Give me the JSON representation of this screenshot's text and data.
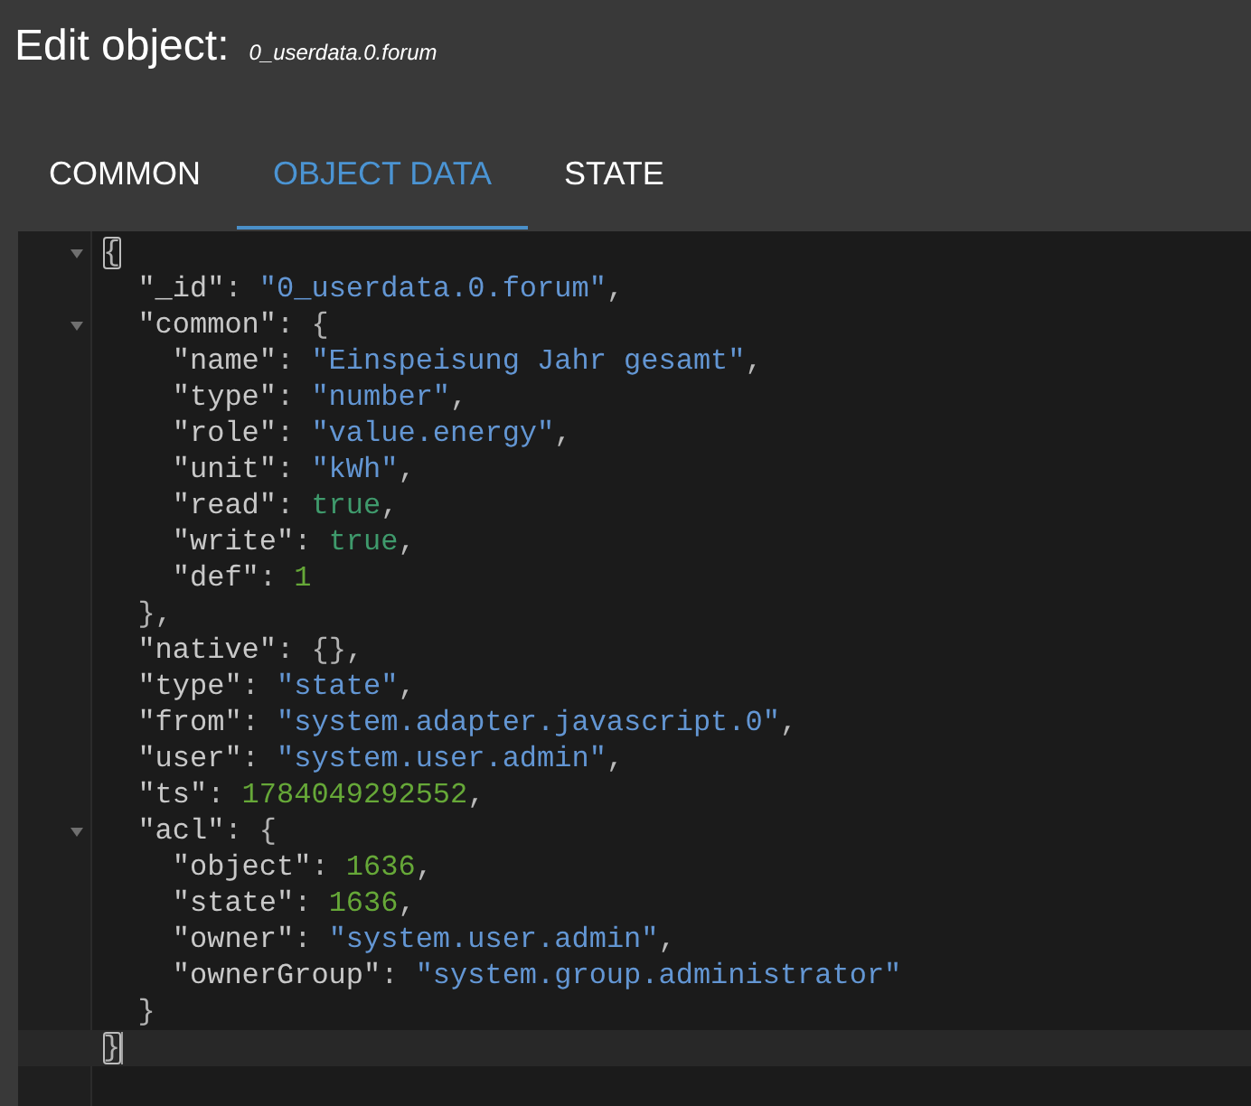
{
  "header": {
    "title": "Edit object:",
    "object_id": "0_userdata.0.forum"
  },
  "tabs": [
    {
      "label": "COMMON",
      "selected": false
    },
    {
      "label": "OBJECT DATA",
      "selected": true
    },
    {
      "label": "STATE",
      "selected": false
    }
  ],
  "editor": {
    "lines": [
      {
        "tokens": [
          {
            "kind": "bracket",
            "text": "{",
            "matched": true
          }
        ],
        "expanded": true,
        "active": false,
        "children": [
          {
            "tokens": [
              {
                "kind": "key",
                "text": "\"_id\""
              },
              {
                "kind": "punct",
                "text": ": "
              },
              {
                "kind": "string",
                "text": "\"0_userdata.0.forum\""
              },
              {
                "kind": "punct",
                "text": ","
              }
            ],
            "active": false
          },
          {
            "tokens": [
              {
                "kind": "key",
                "text": "\"common\""
              },
              {
                "kind": "punct",
                "text": ": "
              },
              {
                "kind": "bracket",
                "text": "{",
                "matched": false
              }
            ],
            "expanded": true,
            "active": false,
            "children": [
              {
                "tokens": [
                  {
                    "kind": "key",
                    "text": "\"name\""
                  },
                  {
                    "kind": "punct",
                    "text": ": "
                  },
                  {
                    "kind": "string",
                    "text": "\"Einspeisung Jahr gesamt\""
                  },
                  {
                    "kind": "punct",
                    "text": ","
                  }
                ],
                "active": false
              },
              {
                "tokens": [
                  {
                    "kind": "key",
                    "text": "\"type\""
                  },
                  {
                    "kind": "punct",
                    "text": ": "
                  },
                  {
                    "kind": "string",
                    "text": "\"number\""
                  },
                  {
                    "kind": "punct",
                    "text": ","
                  }
                ],
                "active": false
              },
              {
                "tokens": [
                  {
                    "kind": "key",
                    "text": "\"role\""
                  },
                  {
                    "kind": "punct",
                    "text": ": "
                  },
                  {
                    "kind": "string",
                    "text": "\"value.energy\""
                  },
                  {
                    "kind": "punct",
                    "text": ","
                  }
                ],
                "active": false
              },
              {
                "tokens": [
                  {
                    "kind": "key",
                    "text": "\"unit\""
                  },
                  {
                    "kind": "punct",
                    "text": ": "
                  },
                  {
                    "kind": "string",
                    "text": "\"kWh\""
                  },
                  {
                    "kind": "punct",
                    "text": ","
                  }
                ],
                "active": false
              },
              {
                "tokens": [
                  {
                    "kind": "key",
                    "text": "\"read\""
                  },
                  {
                    "kind": "punct",
                    "text": ": "
                  },
                  {
                    "kind": "boolean",
                    "text": "true"
                  },
                  {
                    "kind": "punct",
                    "text": ","
                  }
                ],
                "active": false
              },
              {
                "tokens": [
                  {
                    "kind": "key",
                    "text": "\"write\""
                  },
                  {
                    "kind": "punct",
                    "text": ": "
                  },
                  {
                    "kind": "boolean",
                    "text": "true"
                  },
                  {
                    "kind": "punct",
                    "text": ","
                  }
                ],
                "active": false
              },
              {
                "tokens": [
                  {
                    "kind": "key",
                    "text": "\"def\""
                  },
                  {
                    "kind": "punct",
                    "text": ": "
                  },
                  {
                    "kind": "number",
                    "text": "1"
                  }
                ],
                "active": false
              }
            ]
          },
          {
            "tokens": [
              {
                "kind": "bracket",
                "text": "}",
                "matched": false
              },
              {
                "kind": "punct",
                "text": ","
              }
            ],
            "active": false
          },
          {
            "tokens": [
              {
                "kind": "key",
                "text": "\"native\""
              },
              {
                "kind": "punct",
                "text": ": "
              },
              {
                "kind": "bracket",
                "text": "{",
                "matched": false
              },
              {
                "kind": "bracket",
                "text": "}",
                "matched": false
              },
              {
                "kind": "punct",
                "text": ","
              }
            ],
            "active": false
          },
          {
            "tokens": [
              {
                "kind": "key",
                "text": "\"type\""
              },
              {
                "kind": "punct",
                "text": ": "
              },
              {
                "kind": "string",
                "text": "\"state\""
              },
              {
                "kind": "punct",
                "text": ","
              }
            ],
            "active": false
          },
          {
            "tokens": [
              {
                "kind": "key",
                "text": "\"from\""
              },
              {
                "kind": "punct",
                "text": ": "
              },
              {
                "kind": "string",
                "text": "\"system.adapter.javascript.0\""
              },
              {
                "kind": "punct",
                "text": ","
              }
            ],
            "active": false
          },
          {
            "tokens": [
              {
                "kind": "key",
                "text": "\"user\""
              },
              {
                "kind": "punct",
                "text": ": "
              },
              {
                "kind": "string",
                "text": "\"system.user.admin\""
              },
              {
                "kind": "punct",
                "text": ","
              }
            ],
            "active": false
          },
          {
            "tokens": [
              {
                "kind": "key",
                "text": "\"ts\""
              },
              {
                "kind": "punct",
                "text": ": "
              },
              {
                "kind": "number",
                "text": "1784049292552"
              },
              {
                "kind": "punct",
                "text": ","
              }
            ],
            "active": false
          },
          {
            "tokens": [
              {
                "kind": "key",
                "text": "\"acl\""
              },
              {
                "kind": "punct",
                "text": ": "
              },
              {
                "kind": "bracket",
                "text": "{",
                "matched": false
              }
            ],
            "expanded": true,
            "active": false,
            "children": [
              {
                "tokens": [
                  {
                    "kind": "key",
                    "text": "\"object\""
                  },
                  {
                    "kind": "punct",
                    "text": ": "
                  },
                  {
                    "kind": "number",
                    "text": "1636"
                  },
                  {
                    "kind": "punct",
                    "text": ","
                  }
                ],
                "active": false
              },
              {
                "tokens": [
                  {
                    "kind": "key",
                    "text": "\"state\""
                  },
                  {
                    "kind": "punct",
                    "text": ": "
                  },
                  {
                    "kind": "number",
                    "text": "1636"
                  },
                  {
                    "kind": "punct",
                    "text": ","
                  }
                ],
                "active": false
              },
              {
                "tokens": [
                  {
                    "kind": "key",
                    "text": "\"owner\""
                  },
                  {
                    "kind": "punct",
                    "text": ": "
                  },
                  {
                    "kind": "string",
                    "text": "\"system.user.admin\""
                  },
                  {
                    "kind": "punct",
                    "text": ","
                  }
                ],
                "active": false
              },
              {
                "tokens": [
                  {
                    "kind": "key",
                    "text": "\"ownerGroup\""
                  },
                  {
                    "kind": "punct",
                    "text": ": "
                  },
                  {
                    "kind": "string",
                    "text": "\"system.group.administrator\""
                  }
                ],
                "active": false
              }
            ]
          },
          {
            "tokens": [
              {
                "kind": "bracket",
                "text": "}",
                "matched": false
              }
            ],
            "active": false
          }
        ]
      },
      {
        "tokens": [
          {
            "kind": "bracket",
            "text": "}",
            "matched": true
          }
        ],
        "active": true
      }
    ]
  }
}
